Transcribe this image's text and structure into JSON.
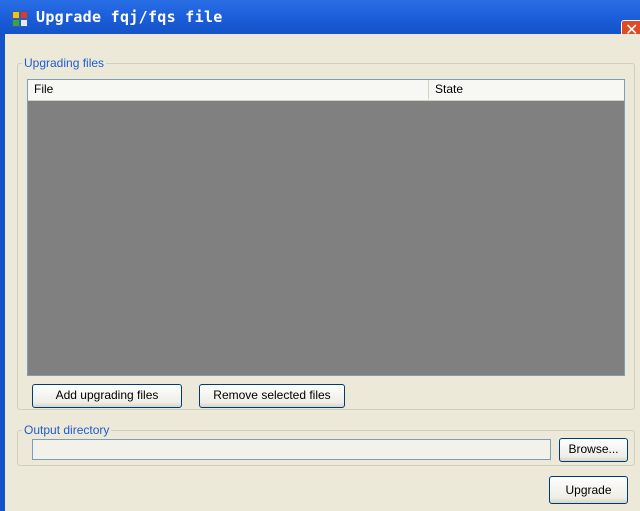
{
  "window": {
    "title": "Upgrade fqj/fqs file",
    "close_glyph": "✕",
    "title_icon": "app-window-icon"
  },
  "upgrading_group": {
    "label": "Upgrading files",
    "columns": [
      "File",
      "State"
    ],
    "rows": [],
    "add_button": "Add upgrading files",
    "remove_button": "Remove selected files"
  },
  "output_group": {
    "label": "Output directory",
    "path_value": "",
    "browse_button": "Browse..."
  },
  "upgrade_button": "Upgrade",
  "colors": {
    "titlebar": "#1d5fdc",
    "group_label": "#1f5bd1",
    "list_background": "#808080",
    "dialog_background": "#ece9d8",
    "close_button": "#e04a25"
  }
}
